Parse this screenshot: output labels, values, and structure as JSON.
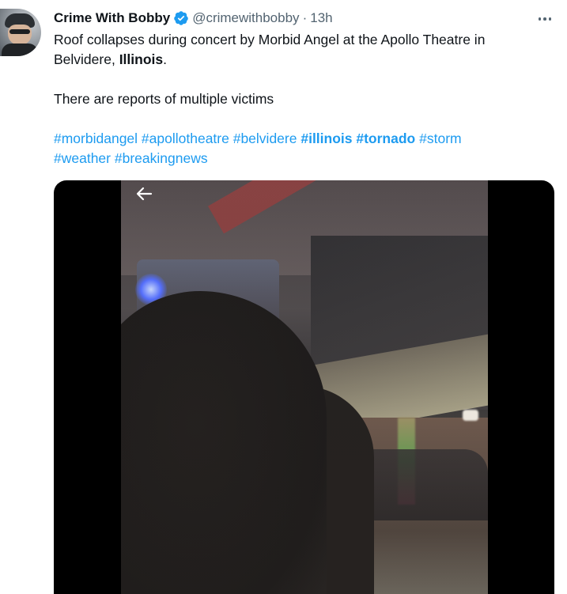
{
  "author": {
    "name": "Crime With Bobby",
    "handle": "@crimewithbobby",
    "separator": "·",
    "time": "13h"
  },
  "icons": {
    "verified": "verified-badge-icon",
    "more": "more-options-icon",
    "back": "back-arrow-icon"
  },
  "colors": {
    "accent": "#1d9bf0",
    "text": "#0f1419",
    "muted": "#536471"
  },
  "tweet": {
    "line1": "Roof collapses during concert by Morbid Angel at the Apollo Theatre in",
    "line2_plain": "Belvidere, ",
    "line2_bold": "Illinois",
    "line2_end": ".",
    "line3": "There are reports of multiple victims",
    "hashtags_row1": [
      {
        "text": "#morbidangel",
        "bold": false
      },
      {
        "text": "#apollotheatre",
        "bold": false
      },
      {
        "text": "#belvidere",
        "bold": false
      },
      {
        "text": "#illinois",
        "bold": true
      },
      {
        "text": "#tornado",
        "bold": true
      },
      {
        "text": "#storm",
        "bold": false
      }
    ],
    "hashtags_row2": [
      {
        "text": "#weather",
        "bold": false
      },
      {
        "text": "#breakingnews",
        "bold": false
      }
    ]
  }
}
